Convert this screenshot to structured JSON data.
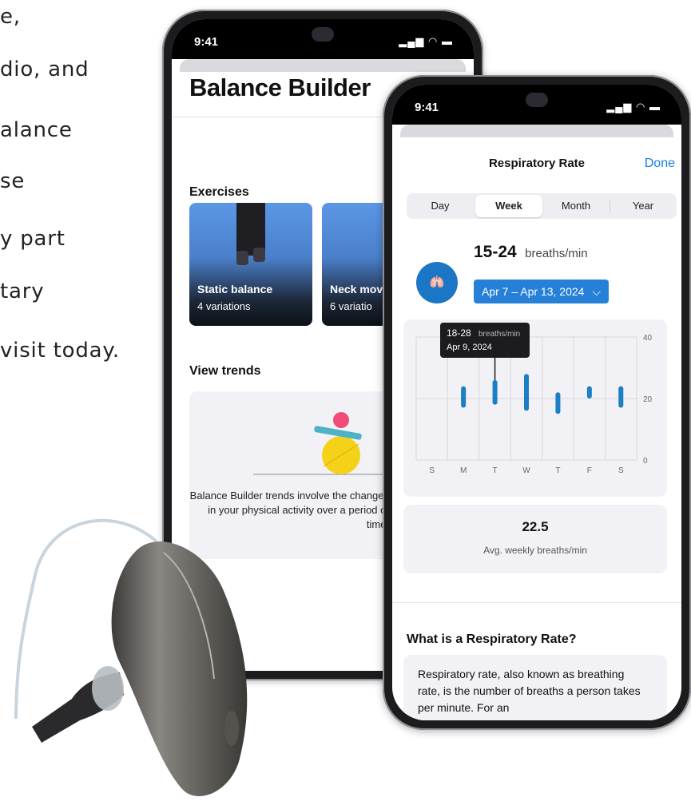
{
  "background_text": [
    "e,",
    "dio, and",
    "alance",
    "se",
    "y part",
    "tary",
    "visit today."
  ],
  "phone_back": {
    "time": "9:41",
    "title": "Balance Builder",
    "exercises_heading": "Exercises",
    "exercises": [
      {
        "name": "Static balance",
        "sub": "4 variations"
      },
      {
        "name": "Neck mov",
        "sub": "6 variatio"
      }
    ],
    "view_trends_heading": "View trends",
    "trends_text": "Balance Builder trends involve the changes in your physical activity over a period of time."
  },
  "phone_front": {
    "time": "9:41",
    "nav_title": "Respiratory Rate",
    "done_label": "Done",
    "segments": [
      "Day",
      "Week",
      "Month",
      "Year"
    ],
    "selected_segment": "Week",
    "icon_glyph": "🫁",
    "value_range": "15-24",
    "value_unit": "breaths/min",
    "date_range": "Apr 7 – Apr 13, 2024",
    "date_chevron": "⌵",
    "avg_value": "22.5",
    "avg_label": "Avg. weekly breaths/min",
    "what_heading": "What is a Respiratory Rate?",
    "what_text": "Respiratory rate, also known as breathing rate, is the number of breaths a person takes per minute. For an"
  },
  "chart_data": {
    "type": "bar",
    "categories": [
      "S",
      "M",
      "T",
      "W",
      "T",
      "F",
      "S"
    ],
    "series": [
      {
        "low": [
          null,
          17,
          18,
          16,
          15,
          20,
          17
        ],
        "high": [
          null,
          24,
          26,
          28,
          22,
          24,
          24
        ]
      }
    ],
    "ylim": [
      0,
      40
    ],
    "y_ticks": [
      "40",
      "20",
      "0"
    ],
    "tooltip": {
      "range": "18-28",
      "unit": "breaths/min",
      "date": "Apr 9, 2024"
    },
    "color": "#1a7fc4"
  }
}
